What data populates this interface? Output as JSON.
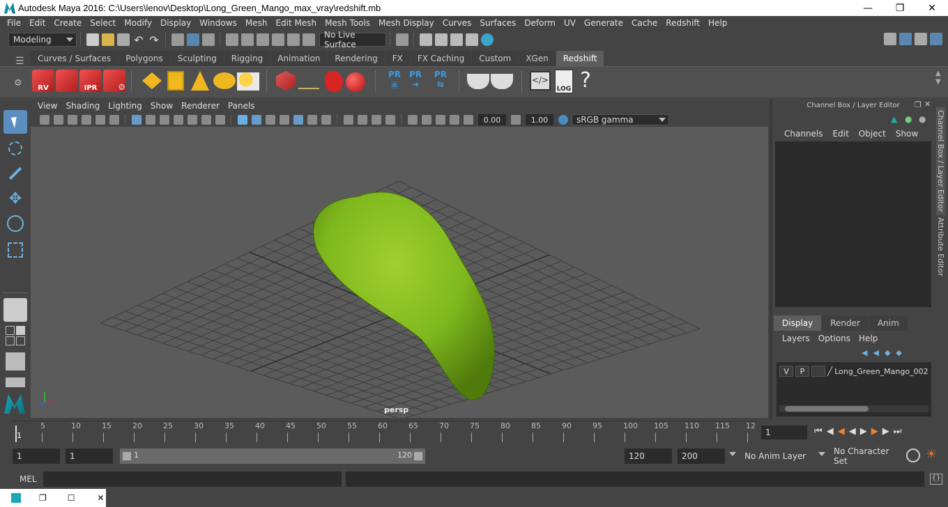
{
  "window": {
    "title": "Autodesk Maya 2016: C:\\Users\\lenov\\Desktop\\Long_Green_Mango_max_vray\\redshift.mb"
  },
  "menubar": [
    "File",
    "Edit",
    "Create",
    "Select",
    "Modify",
    "Display",
    "Windows",
    "Mesh",
    "Edit Mesh",
    "Mesh Tools",
    "Mesh Display",
    "Curves",
    "Surfaces",
    "Deform",
    "UV",
    "Generate",
    "Cache",
    "Redshift",
    "Help"
  ],
  "status": {
    "mode": "Modeling",
    "live_surface": "No Live Surface"
  },
  "shelf_tabs": [
    "Curves / Surfaces",
    "Polygons",
    "Sculpting",
    "Rigging",
    "Animation",
    "Rendering",
    "FX",
    "FX Caching",
    "Custom",
    "XGen",
    "Redshift"
  ],
  "shelf_active": "Redshift",
  "shelf_labels": {
    "rv": "RV",
    "ipr": "IPR",
    "pr1": "PR",
    "pr2": "PR",
    "pr3": "PR",
    "log": "LOG",
    "help": "?"
  },
  "viewport": {
    "menu": [
      "View",
      "Shading",
      "Lighting",
      "Show",
      "Renderer",
      "Panels"
    ],
    "exposure": "0.00",
    "gamma": "1.00",
    "color_space": "sRGB gamma",
    "camera_label": "persp"
  },
  "channel_box": {
    "header": "Channel Box / Layer Editor",
    "menu": [
      "Channels",
      "Edit",
      "Object",
      "Show"
    ]
  },
  "layer_editor": {
    "tabs": [
      "Display",
      "Render",
      "Anim"
    ],
    "active_tab": "Display",
    "menu": [
      "Layers",
      "Options",
      "Help"
    ],
    "layer": {
      "v": "V",
      "p": "P",
      "name": "Long_Green_Mango_002"
    }
  },
  "side_tabs": [
    "Channel Box / Layer Editor",
    "Attribute Editor"
  ],
  "timeline": {
    "ticks": [
      "5",
      "10",
      "15",
      "20",
      "25",
      "30",
      "35",
      "40",
      "45",
      "50",
      "55",
      "60",
      "65",
      "70",
      "75",
      "80",
      "85",
      "90",
      "95",
      "100",
      "105",
      "110",
      "115",
      "12"
    ],
    "start_marker": "1",
    "current_frame": "1"
  },
  "range": {
    "start": "1",
    "playback_start": "1",
    "slider_start": "1",
    "slider_end": "120",
    "playback_end": "120",
    "end": "200",
    "anim_layer": "No Anim Layer",
    "character_set": "No Character Set"
  },
  "command": {
    "label": "MEL"
  },
  "colors": {
    "mango": "#7fb81e",
    "grid": "#3a3a3a",
    "accent": "#4b8bbf"
  }
}
